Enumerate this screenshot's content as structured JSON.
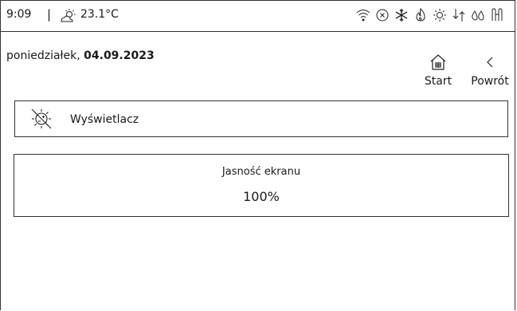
{
  "status_bar": {
    "time": "9:09",
    "separator": "|",
    "temperature": "23.1°C",
    "weather_icon": "partly-sunny-icon",
    "icons": [
      "wifi-icon",
      "error-circle-icon",
      "snowflake-icon",
      "flame-icon",
      "sun-gear-icon",
      "arrows-icon",
      "drops-icon",
      "thermometer-icon"
    ]
  },
  "header": {
    "day": "poniedziałek,",
    "date": "04.09.2023"
  },
  "nav": {
    "start_label": "Start",
    "back_label": "Powrót"
  },
  "section": {
    "label": "Wyświetlacz",
    "icon": "display-brightness-icon"
  },
  "brightness": {
    "title": "Jasność ekranu",
    "value": "100%"
  }
}
